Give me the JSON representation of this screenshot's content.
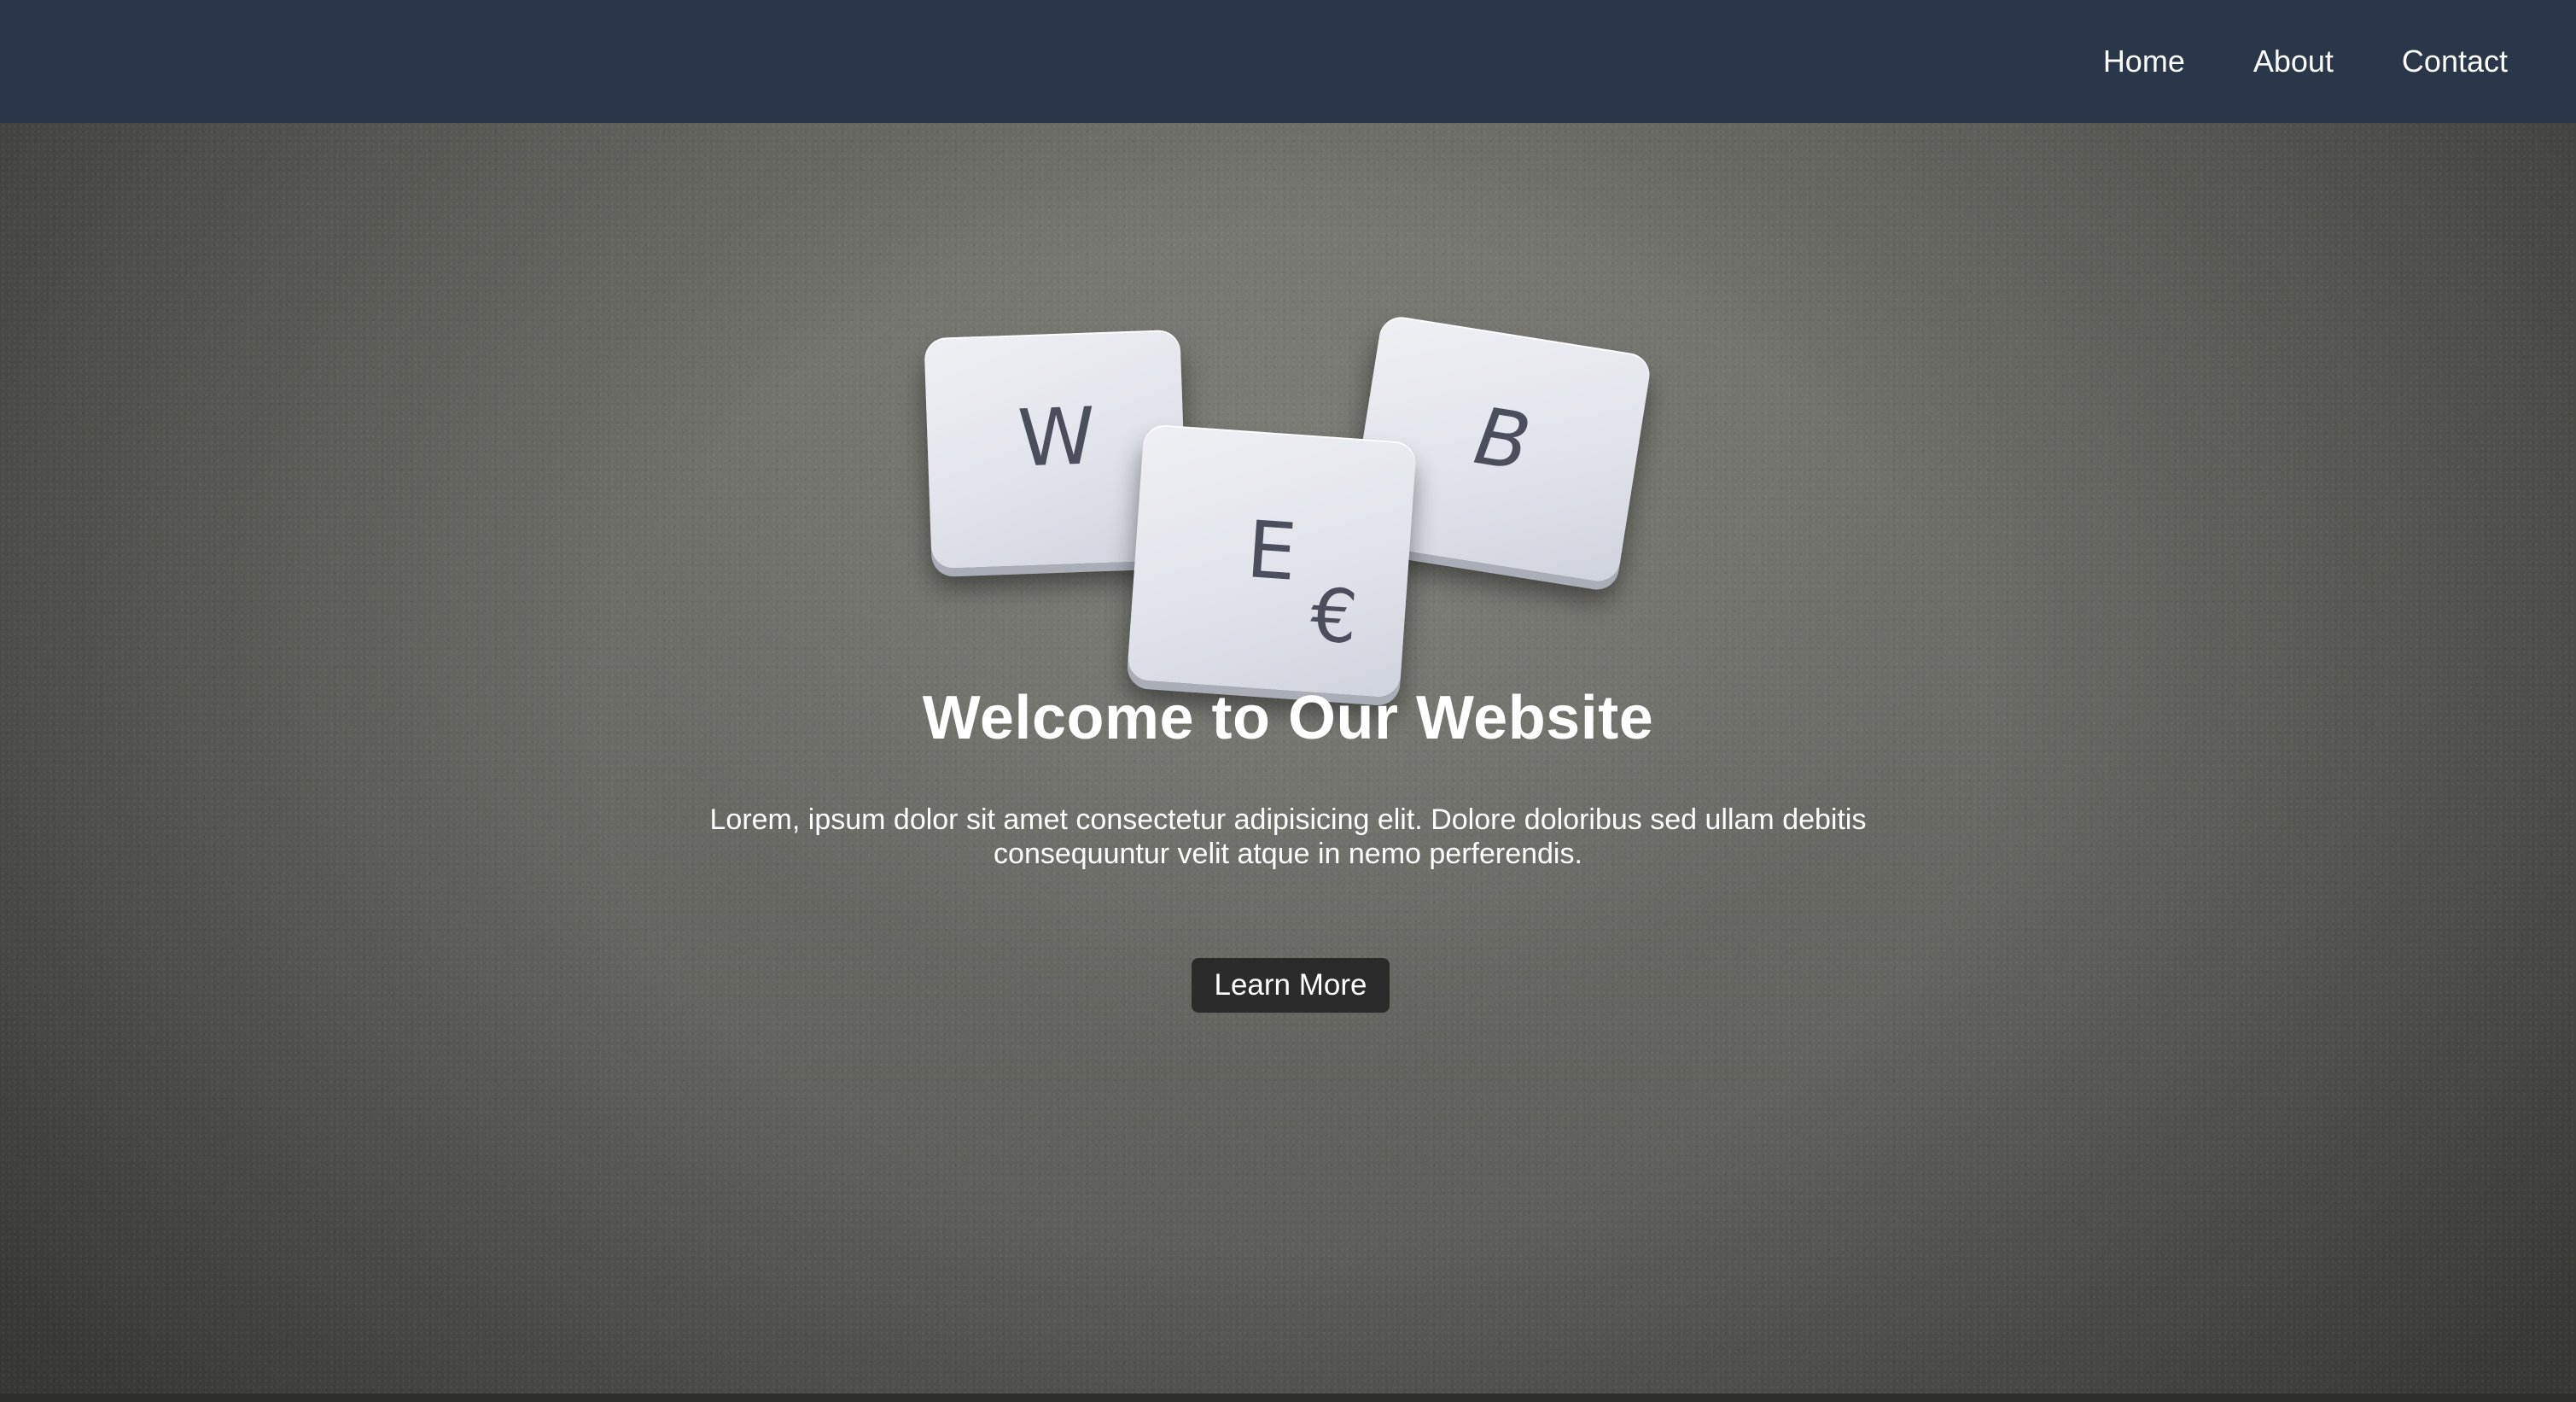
{
  "nav": {
    "items": [
      {
        "label": "Home"
      },
      {
        "label": "About"
      },
      {
        "label": "Contact"
      }
    ]
  },
  "hero": {
    "tiles": {
      "w": "W",
      "e": "E",
      "euro": "€",
      "b": "B"
    },
    "title": "Welcome to Our Website",
    "subtitle_lines": [
      "Lorem, ipsum dolor sit amet consectetur adipisicing elit. Dolore doloribus sed ullam debitis",
      "consequuntur velit atque in nemo perferendis."
    ],
    "button_label": "Learn More"
  },
  "colors": {
    "nav_bg": "#2a3649",
    "button_bg": "#2b2b2b",
    "text": "#ffffff"
  }
}
